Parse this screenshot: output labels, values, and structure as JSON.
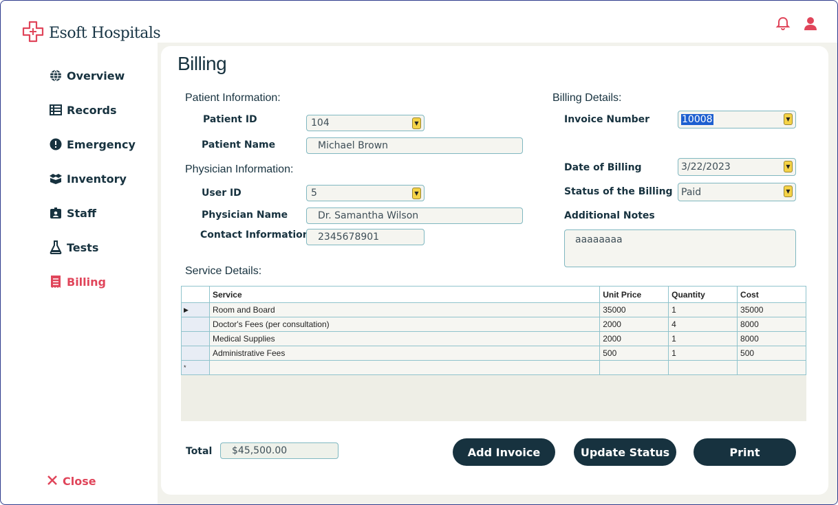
{
  "app": {
    "name": "Esoft Hospitals"
  },
  "sidebar": {
    "items": [
      {
        "label": "Overview",
        "icon": "globe-icon"
      },
      {
        "label": "Records",
        "icon": "table-icon"
      },
      {
        "label": "Emergency",
        "icon": "alert-icon"
      },
      {
        "label": "Inventory",
        "icon": "boxes-icon"
      },
      {
        "label": "Staff",
        "icon": "id-badge-icon"
      },
      {
        "label": "Tests",
        "icon": "flask-icon"
      },
      {
        "label": "Billing",
        "icon": "receipt-icon"
      }
    ],
    "active": "Billing",
    "close_label": "Close"
  },
  "page": {
    "title": "Billing"
  },
  "patient": {
    "section": "Patient Information:",
    "id_label": "Patient ID",
    "id_value": "104",
    "name_label": "Patient Name",
    "name_value": "Michael Brown"
  },
  "physician": {
    "section": "Physician Information:",
    "user_id_label": "User ID",
    "user_id_value": "5",
    "name_label": "Physician Name",
    "name_value": "Dr. Samantha Wilson",
    "contact_label": "Contact Information",
    "contact_value": "2345678901"
  },
  "billing": {
    "section": "Billing Details:",
    "invoice_label": "Invoice Number",
    "invoice_value": "10008",
    "date_label": "Date of Billing",
    "date_value": "3/22/2023",
    "status_label": "Status of the Billing",
    "status_value": "Paid",
    "notes_label": "Additional Notes",
    "notes_value": "aaaaaaaa"
  },
  "services": {
    "section": "Service Details:",
    "columns": [
      "Service",
      "Unit Price",
      "Quantity",
      "Cost"
    ],
    "rows": [
      {
        "service": "Room and Board",
        "unit_price": "35000",
        "quantity": "1",
        "cost": "35000"
      },
      {
        "service": "Doctor's Fees (per consultation)",
        "unit_price": "2000",
        "quantity": "4",
        "cost": "8000"
      },
      {
        "service": "Medical Supplies",
        "unit_price": "2000",
        "quantity": "1",
        "cost": "8000"
      },
      {
        "service": "Administrative Fees",
        "unit_price": "500",
        "quantity": "1",
        "cost": "500"
      }
    ],
    "new_row_marker": "*",
    "current_row_marker": "▶"
  },
  "footer": {
    "total_label": "Total",
    "total_value": "$45,500.00",
    "add_invoice": "Add Invoice",
    "update_status": "Update Status",
    "print": "Print"
  },
  "colors": {
    "accent": "#e0455a",
    "navy": "#17323f",
    "field_border": "#7fb7c0",
    "dropdown": "#f5d347"
  }
}
